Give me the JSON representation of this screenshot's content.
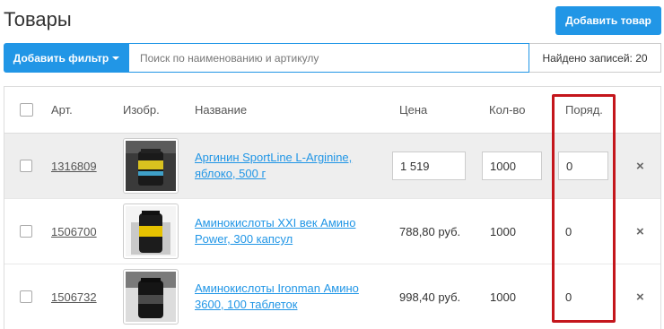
{
  "header": {
    "title": "Товары",
    "add_product_label": "Добавить товар"
  },
  "filter": {
    "add_filter_label": "Добавить фильтр",
    "search_placeholder": "Поиск по наименованию и артикулу",
    "found_text": "Найдено записей: 20"
  },
  "table": {
    "columns": {
      "article": "Арт.",
      "image": "Изобр.",
      "name": "Название",
      "price": "Цена",
      "quantity": "Кол-во",
      "order": "Поряд."
    },
    "rows": [
      {
        "article": "1316809",
        "name_line1": "Аргинин SportLine L-Arginine,",
        "name_line2": "яблоко, 500 г",
        "price": "1 519",
        "quantity": "1000",
        "order": "0",
        "editing": true,
        "thumb_label": "L-ARGININE"
      },
      {
        "article": "1506700",
        "name_line1": "Аминокислоты XXI век Амино",
        "name_line2": "Power, 300 капсул",
        "price": "788,80 руб.",
        "quantity": "1000",
        "order": "0",
        "editing": false,
        "thumb_label": "AMINO POWER"
      },
      {
        "article": "1506732",
        "name_line1": "Аминокислоты Ironman Амино",
        "name_line2": "3600, 100 таблеток",
        "price": "998,40 руб.",
        "quantity": "1000",
        "order": "0",
        "editing": false,
        "thumb_label": "AMINO 3600"
      }
    ],
    "delete_icon": "×"
  },
  "colors": {
    "accent": "#2196e6",
    "highlight_frame": "#c4161c",
    "row_highlight": "#eeeeee"
  }
}
